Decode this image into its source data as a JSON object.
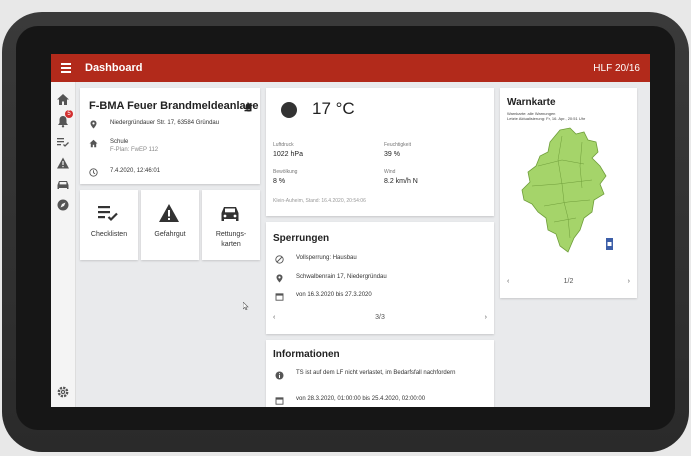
{
  "app": {
    "title": "Dashboard",
    "unit": "HLF 20/16"
  },
  "rail": {
    "badge_count": "5"
  },
  "alarm": {
    "title": "F-BMA Feuer Brandmeldeanlage",
    "address": "Niedergründauer Str. 17, 63584 Gründau",
    "object_name": "Schule",
    "object_plan": "F-Plan: FwEP 112",
    "datetime": "7.4.2020, 12:46:01"
  },
  "tiles": [
    {
      "label": "Checklisten"
    },
    {
      "label": "Gefahrgut"
    },
    {
      "label": "Rettungs-\nkarten"
    }
  ],
  "weather": {
    "temperature": "17 °C",
    "pressure_label": "Luftdruck",
    "pressure_value": "1022 hPa",
    "humidity_label": "Feuchtigkeit",
    "humidity_value": "39 %",
    "clouds_label": "Bewölkung",
    "clouds_value": "8 %",
    "wind_label": "Wind",
    "wind_value": "8.2 km/h N",
    "footer": "Klein-Auheim, Stand: 16.4.2020, 20:54:06"
  },
  "closures": {
    "title": "Sperrungen",
    "item_type": "Vollsperrung: Hausbau",
    "item_address": "Schwalbenrain 17, Niedergründau",
    "item_period": "von 16.3.2020 bis 27.3.2020",
    "pager": "3/3"
  },
  "info": {
    "title": "Informationen",
    "text": "TS ist auf dem LF nicht verlastet, im Bedarfsfall nachfordern",
    "period": "von 28.3.2020, 01:00:00 bis 25.4.2020, 02:00:00"
  },
  "warning_map": {
    "title": "Warnkarte",
    "caption_line1": "Warnkarte: alle Warnungen",
    "caption_line2": "Letzte Aktualisierung: Fr, 16. Apr., 20:51 Uhr",
    "pager": "1/2",
    "region_color": "#a5d46a"
  },
  "colors": {
    "accent": "#b22a1b"
  }
}
